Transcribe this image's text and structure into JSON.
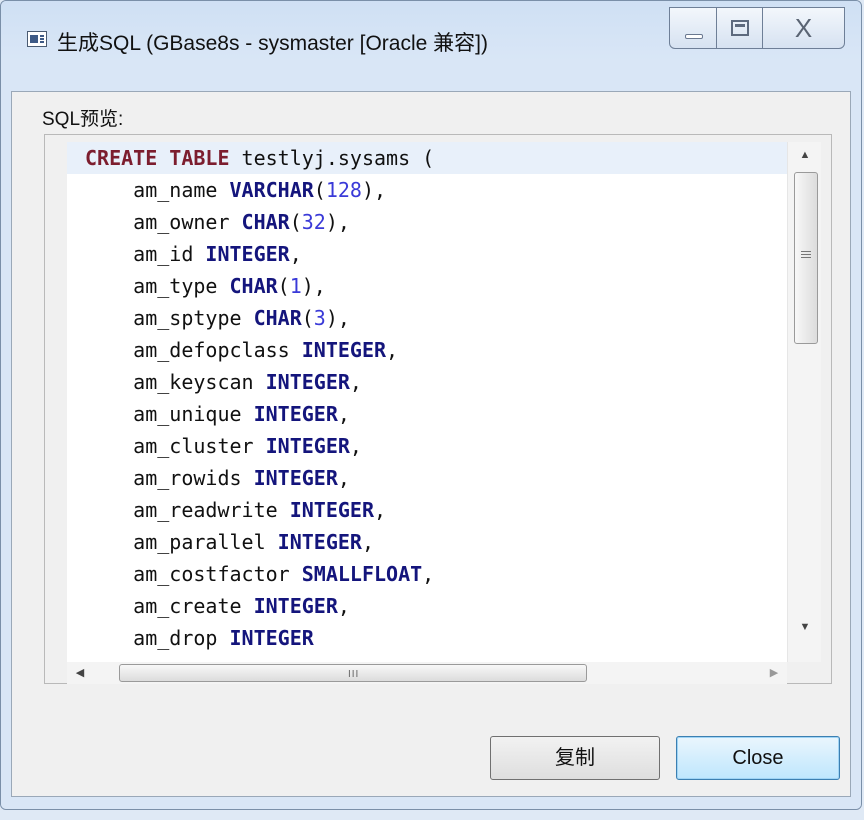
{
  "window": {
    "title": "生成SQL (GBase8s - sysmaster [Oracle 兼容])",
    "close_glyph": "X"
  },
  "main": {
    "sql_label": "SQL预览:",
    "code_lines": [
      [
        {
          "t": "CREATE TABLE",
          "c": "kw-red"
        },
        {
          "t": " testlyj.sysams ("
        }
      ],
      [
        {
          "t": "    am_name "
        },
        {
          "t": "VARCHAR",
          "c": "kw"
        },
        {
          "t": "("
        },
        {
          "t": "128",
          "c": "num"
        },
        {
          "t": "),"
        }
      ],
      [
        {
          "t": "    am_owner "
        },
        {
          "t": "CHAR",
          "c": "kw"
        },
        {
          "t": "("
        },
        {
          "t": "32",
          "c": "num"
        },
        {
          "t": "),"
        }
      ],
      [
        {
          "t": "    am_id "
        },
        {
          "t": "INTEGER",
          "c": "kw"
        },
        {
          "t": ","
        }
      ],
      [
        {
          "t": "    am_type "
        },
        {
          "t": "CHAR",
          "c": "kw"
        },
        {
          "t": "("
        },
        {
          "t": "1",
          "c": "num"
        },
        {
          "t": "),"
        }
      ],
      [
        {
          "t": "    am_sptype "
        },
        {
          "t": "CHAR",
          "c": "kw"
        },
        {
          "t": "("
        },
        {
          "t": "3",
          "c": "num"
        },
        {
          "t": "),"
        }
      ],
      [
        {
          "t": "    am_defopclass "
        },
        {
          "t": "INTEGER",
          "c": "kw"
        },
        {
          "t": ","
        }
      ],
      [
        {
          "t": "    am_keyscan "
        },
        {
          "t": "INTEGER",
          "c": "kw"
        },
        {
          "t": ","
        }
      ],
      [
        {
          "t": "    am_unique "
        },
        {
          "t": "INTEGER",
          "c": "kw"
        },
        {
          "t": ","
        }
      ],
      [
        {
          "t": "    am_cluster "
        },
        {
          "t": "INTEGER",
          "c": "kw"
        },
        {
          "t": ","
        }
      ],
      [
        {
          "t": "    am_rowids "
        },
        {
          "t": "INTEGER",
          "c": "kw"
        },
        {
          "t": ","
        }
      ],
      [
        {
          "t": "    am_readwrite "
        },
        {
          "t": "INTEGER",
          "c": "kw"
        },
        {
          "t": ","
        }
      ],
      [
        {
          "t": "    am_parallel "
        },
        {
          "t": "INTEGER",
          "c": "kw"
        },
        {
          "t": ","
        }
      ],
      [
        {
          "t": "    am_costfactor "
        },
        {
          "t": "SMALLFLOAT",
          "c": "kw"
        },
        {
          "t": ","
        }
      ],
      [
        {
          "t": "    am_create "
        },
        {
          "t": "INTEGER",
          "c": "kw"
        },
        {
          "t": ","
        }
      ],
      [
        {
          "t": "    am_drop "
        },
        {
          "t": "INTEGER",
          "c": "kw"
        }
      ]
    ],
    "hscroll_grip": "III"
  },
  "footer": {
    "copy_label": "复制",
    "close_label": "Close"
  }
}
